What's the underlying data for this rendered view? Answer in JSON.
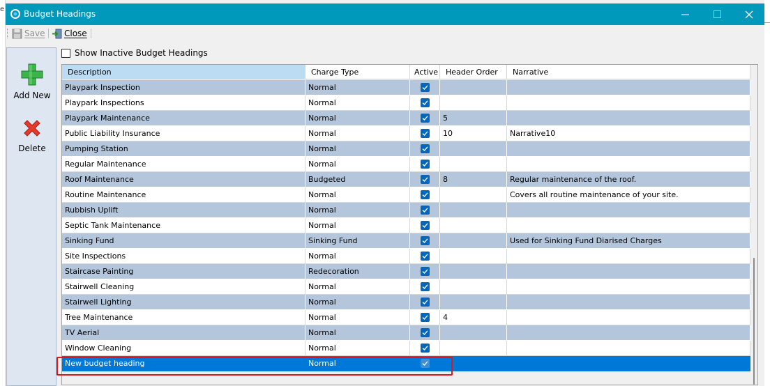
{
  "window": {
    "title": "Budget Headings"
  },
  "toolbar": {
    "save_label": "Save",
    "close_label": "Close"
  },
  "side": {
    "add_label": "Add New",
    "delete_label": "Delete"
  },
  "filter": {
    "show_inactive_label": "Show Inactive Budget Headings",
    "show_inactive_checked": false
  },
  "grid": {
    "columns": [
      "Description",
      "Charge Type",
      "Active",
      "Header Order",
      "Narrative"
    ],
    "rows": [
      {
        "description": "Playpark Inspection",
        "charge_type": "Normal",
        "active": true,
        "header_order": "",
        "narrative": ""
      },
      {
        "description": "Playpark Inspections",
        "charge_type": "Normal",
        "active": true,
        "header_order": "",
        "narrative": ""
      },
      {
        "description": "Playpark Maintenance",
        "charge_type": "Normal",
        "active": true,
        "header_order": "5",
        "narrative": ""
      },
      {
        "description": "Public Liability Insurance",
        "charge_type": "Normal",
        "active": true,
        "header_order": "10",
        "narrative": "Narrative10"
      },
      {
        "description": "Pumping Station",
        "charge_type": "Normal",
        "active": true,
        "header_order": "",
        "narrative": ""
      },
      {
        "description": "Regular Maintenance",
        "charge_type": "Normal",
        "active": true,
        "header_order": "",
        "narrative": ""
      },
      {
        "description": "Roof Maintenance",
        "charge_type": "Budgeted",
        "active": true,
        "header_order": "8",
        "narrative": "Regular maintenance of the roof."
      },
      {
        "description": "Routine Maintenance",
        "charge_type": "Normal",
        "active": true,
        "header_order": "",
        "narrative": "Covers all routine maintenance of your site."
      },
      {
        "description": "Rubbish Uplift",
        "charge_type": "Normal",
        "active": true,
        "header_order": "",
        "narrative": ""
      },
      {
        "description": "Septic Tank Maintenance",
        "charge_type": "Normal",
        "active": true,
        "header_order": "",
        "narrative": ""
      },
      {
        "description": "Sinking Fund",
        "charge_type": "Sinking Fund",
        "active": true,
        "header_order": "",
        "narrative": "Used for Sinking Fund Diarised Charges"
      },
      {
        "description": "Site Inspections",
        "charge_type": "Normal",
        "active": true,
        "header_order": "",
        "narrative": ""
      },
      {
        "description": "Staircase Painting",
        "charge_type": "Redecoration",
        "active": true,
        "header_order": "",
        "narrative": ""
      },
      {
        "description": "Stairwell Cleaning",
        "charge_type": "Normal",
        "active": true,
        "header_order": "",
        "narrative": ""
      },
      {
        "description": "Stairwell Lighting",
        "charge_type": "Normal",
        "active": true,
        "header_order": "",
        "narrative": ""
      },
      {
        "description": "Tree Maintenance",
        "charge_type": "Normal",
        "active": true,
        "header_order": "4",
        "narrative": ""
      },
      {
        "description": "TV Aerial",
        "charge_type": "Normal",
        "active": true,
        "header_order": "",
        "narrative": ""
      },
      {
        "description": "Window Cleaning",
        "charge_type": "Normal",
        "active": true,
        "header_order": "",
        "narrative": ""
      },
      {
        "description": "New budget heading",
        "charge_type": "Normal",
        "active": true,
        "header_order": "",
        "narrative": "",
        "selected": true
      }
    ]
  },
  "colors": {
    "titlebar": "#0099bc",
    "selection": "#0078d7",
    "alt_row": "#b4c6dc",
    "highlight_box": "#e0161b"
  },
  "icons": {
    "app": "app-logo-icon",
    "save": "floppy-disk-icon",
    "close": "exit-door-icon",
    "add": "green-plus-icon",
    "delete": "red-x-icon"
  }
}
